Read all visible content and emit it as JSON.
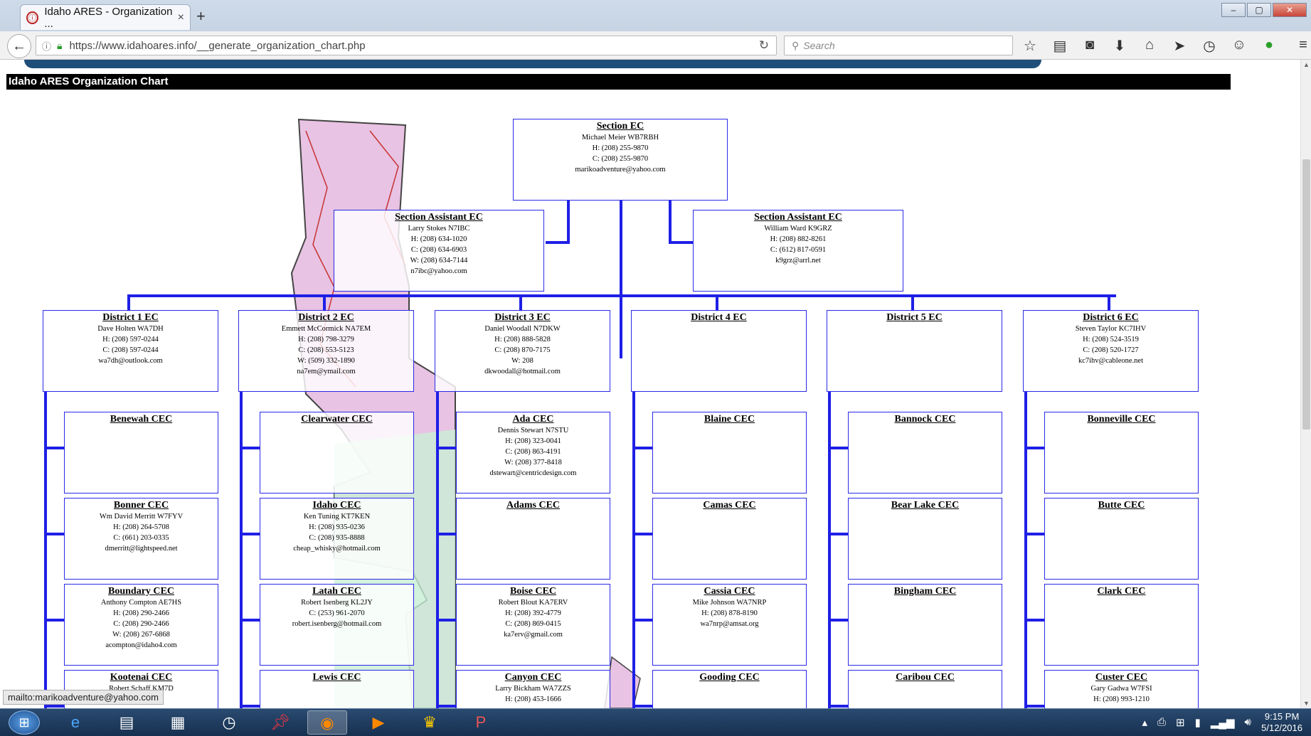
{
  "browser": {
    "tab_title": "Idaho ARES - Organization ...",
    "tab_close": "×",
    "new_tab": "+",
    "url": "https://www.idahoares.info/__generate_organization_chart.php",
    "search_placeholder": "Search",
    "status_url": "mailto:marikoadventure@yahoo.com"
  },
  "page": {
    "title": "Idaho ARES Organization Chart"
  },
  "chart": {
    "section_ec": {
      "title": "Section EC",
      "lines": [
        "Michael Meier WB7RBH",
        "H: (208) 255-9870",
        "C: (208) 255-9870",
        "marikoadventure@yahoo.com"
      ]
    },
    "assistants": [
      {
        "title": "Section Assistant EC",
        "lines": [
          "Larry Stokes N7IBC",
          "H: (208) 634-1020",
          "C: (208) 634-6903",
          "W: (208) 634-7144",
          "n7ibc@yahoo.com"
        ]
      },
      {
        "title": "Section Assistant EC",
        "lines": [
          "William Ward K9GRZ",
          "H: (208) 882-8261",
          "C: (612) 817-0591",
          "k9grz@arrl.net"
        ]
      }
    ],
    "districts": [
      {
        "title": "District 1 EC",
        "lines": [
          "Dave Holten WA7DH",
          "H: (208) 597-0244",
          "C: (208) 597-0244",
          "wa7dh@outlook.com"
        ],
        "cecs": [
          {
            "title": "Benewah CEC",
            "lines": []
          },
          {
            "title": "Bonner CEC",
            "lines": [
              "Wm David Merritt W7FYV",
              "H: (208) 264-5708",
              "C: (661) 203-0335",
              "dmerritt@lightspeed.net"
            ]
          },
          {
            "title": "Boundary CEC",
            "lines": [
              "Anthony Compton AE7HS",
              "H: (208) 290-2466",
              "C: (208) 290-2466",
              "W: (208) 267-6868",
              "acompton@idaho4.com"
            ]
          },
          {
            "title": "Kootenai CEC",
            "lines": [
              "Robert Schaff KM7D"
            ]
          }
        ]
      },
      {
        "title": "District 2 EC",
        "lines": [
          "Emmett McCormick NA7EM",
          "H: (208) 798-3279",
          "C: (208) 553-5123",
          "W: (509) 332-1890",
          "na7em@ymail.com"
        ],
        "cecs": [
          {
            "title": "Clearwater CEC",
            "lines": []
          },
          {
            "title": "Idaho CEC",
            "lines": [
              "Ken Tuning KT7KEN",
              "H: (208) 935-0236",
              "C: (208) 935-8888",
              "cheap_whisky@hotmail.com"
            ]
          },
          {
            "title": "Latah CEC",
            "lines": [
              "Robert Isenberg KL2JY",
              "C: (253) 961-2070",
              "robert.isenberg@hotmail.com"
            ]
          },
          {
            "title": "Lewis CEC",
            "lines": []
          }
        ]
      },
      {
        "title": "District 3 EC",
        "lines": [
          "Daniel Woodall N7DKW",
          "H: (208) 888-5828",
          "C: (208) 870-7175",
          "W: 208",
          "dkwoodall@hotmail.com"
        ],
        "cecs": [
          {
            "title": "Ada CEC",
            "lines": [
              "Dennis Stewart N7STU",
              "H: (208) 323-0041",
              "C: (208) 863-4191",
              "W: (208) 377-8418",
              "dstewart@centricdesign.com"
            ]
          },
          {
            "title": "Adams CEC",
            "lines": []
          },
          {
            "title": "Boise CEC",
            "lines": [
              "Robert Blout KA7ERV",
              "H: (208) 392-4779",
              "C: (208) 869-0415",
              "ka7erv@gmail.com"
            ]
          },
          {
            "title": "Canyon CEC",
            "lines": [
              "Larry Bickham WA7ZZS",
              "H: (208) 453-1666"
            ]
          }
        ]
      },
      {
        "title": "District 4 EC",
        "lines": [],
        "cecs": [
          {
            "title": "Blaine CEC",
            "lines": []
          },
          {
            "title": "Camas CEC",
            "lines": []
          },
          {
            "title": "Cassia CEC",
            "lines": [
              "Mike Johnson WA7NRP",
              "H: (208) 878-8190",
              "wa7nrp@amsat.org"
            ]
          },
          {
            "title": "Gooding CEC",
            "lines": []
          }
        ]
      },
      {
        "title": "District 5 EC",
        "lines": [],
        "cecs": [
          {
            "title": "Bannock CEC",
            "lines": []
          },
          {
            "title": "Bear Lake CEC",
            "lines": []
          },
          {
            "title": "Bingham CEC",
            "lines": []
          },
          {
            "title": "Caribou CEC",
            "lines": []
          }
        ]
      },
      {
        "title": "District 6 EC",
        "lines": [
          "Steven Taylor KC7IHV",
          "H: (208) 524-3519",
          "C: (208) 520-1727",
          "kc7ihv@cableone.net"
        ],
        "cecs": [
          {
            "title": "Bonneville CEC",
            "lines": []
          },
          {
            "title": "Butte CEC",
            "lines": []
          },
          {
            "title": "Clark CEC",
            "lines": []
          },
          {
            "title": "Custer CEC",
            "lines": [
              "Gary Gadwa W7FSI",
              "H: (208) 993-1210"
            ]
          }
        ]
      }
    ]
  },
  "taskbar": {
    "time": "9:15 PM",
    "date": "5/12/2016"
  },
  "colors": {
    "connector": "#1f1fe6",
    "map_pink": "#e8c3e3",
    "map_green": "#c8efd6",
    "title_bar": "#000000"
  }
}
